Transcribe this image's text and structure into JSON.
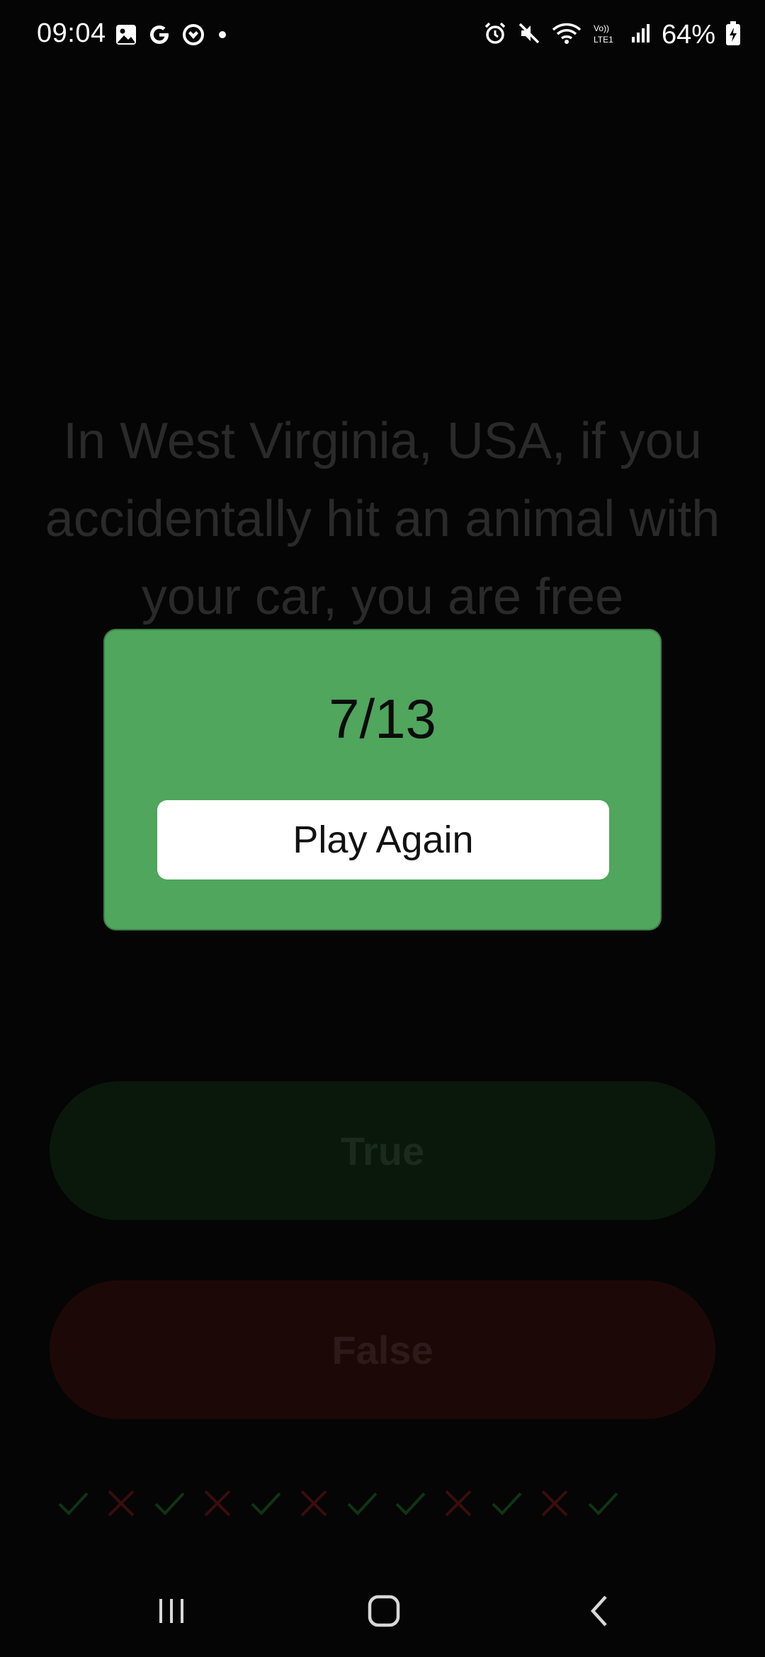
{
  "status_bar": {
    "time": "09:04",
    "battery": "64%",
    "left_icons": [
      "gallery-icon",
      "google-icon",
      "app-icon",
      "dot-icon"
    ],
    "right_icons": [
      "alarm-icon",
      "mute-icon",
      "wifi-icon",
      "volte-icon",
      "signal-icon",
      "battery-icon"
    ]
  },
  "question": {
    "text": "In West Virginia, USA, if you accidentally hit an animal with your car, you are free"
  },
  "answers": {
    "true_label": "True",
    "false_label": "False"
  },
  "progress": {
    "results": [
      "correct",
      "wrong",
      "correct",
      "wrong",
      "correct",
      "wrong",
      "correct",
      "correct",
      "wrong",
      "correct",
      "wrong",
      "correct"
    ]
  },
  "dialog": {
    "score": "7/13",
    "button_label": "Play Again"
  },
  "nav_bar": {
    "buttons": [
      "recent-apps-icon",
      "home-icon",
      "back-icon"
    ]
  },
  "colors": {
    "dialog_bg": "#4fa65c",
    "true_bg": "#0a180c",
    "false_bg": "#1d0808",
    "correct_mark": "#0f3515",
    "wrong_mark": "#3b0d0d"
  }
}
